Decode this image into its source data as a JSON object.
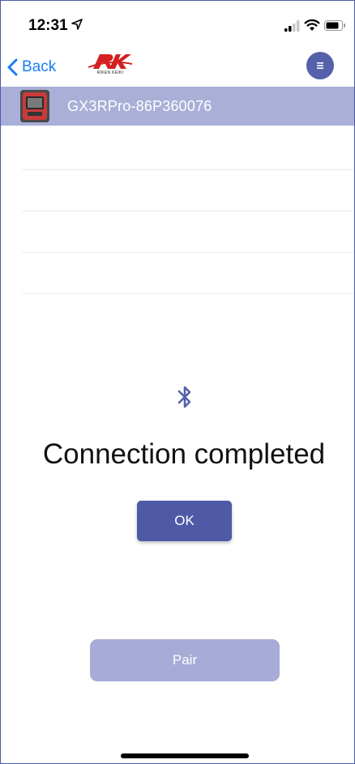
{
  "status_bar": {
    "time": "12:31",
    "icons": [
      "location-arrow-icon",
      "signal-icon",
      "wifi-icon",
      "battery-icon"
    ]
  },
  "nav": {
    "back_label": "Back",
    "logo_text": "RIKEN KEIKI",
    "menu_icon": "menu-icon"
  },
  "device": {
    "name": "GX3RPro-86P360076"
  },
  "dialog": {
    "icon": "bluetooth-icon",
    "message": "Connection completed",
    "ok_label": "OK"
  },
  "actions": {
    "pair_label": "Pair"
  },
  "colors": {
    "accent": "#5561ab",
    "device_bar": "#a9afd7",
    "ios_blue": "#1a7cf5",
    "pair_disabled": "#a7acd6"
  }
}
